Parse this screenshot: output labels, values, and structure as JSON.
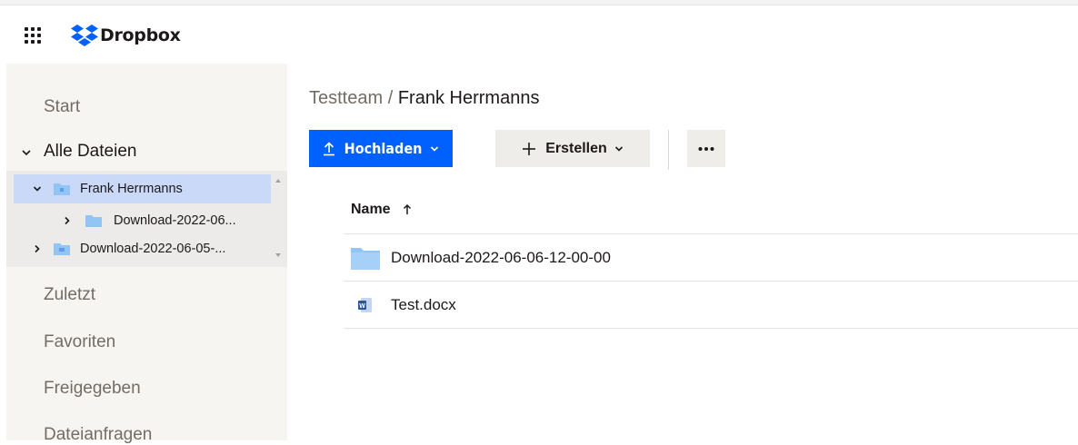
{
  "header": {
    "brand": "Dropbox"
  },
  "sidebar": {
    "items": [
      {
        "label": "Start"
      },
      {
        "label": "Alle Dateien"
      },
      {
        "label": "Zuletzt"
      },
      {
        "label": "Favoriten"
      },
      {
        "label": "Freigegeben"
      },
      {
        "label": "Dateianfragen"
      }
    ],
    "tree": [
      {
        "label": "Frank Herrmanns",
        "selected": true
      },
      {
        "label": "Download-2022-06..."
      },
      {
        "label": "Download-2022-06-05-..."
      }
    ]
  },
  "breadcrumb": {
    "root": "Testteam",
    "separator": "/",
    "current": "Frank Herrmanns"
  },
  "toolbar": {
    "upload_label": "Hochladen",
    "create_label": "Erstellen"
  },
  "table": {
    "column_name": "Name",
    "rows": [
      {
        "name": "Download-2022-06-06-12-00-00",
        "icon": "folder-icon"
      },
      {
        "name": "Test.docx",
        "icon": "word-doc-icon"
      }
    ]
  },
  "colors": {
    "accent": "#0061fe",
    "sidebar_bg": "#f7f5f2",
    "selected_bg": "#c9d9f7",
    "folder": "#92c5f5"
  }
}
